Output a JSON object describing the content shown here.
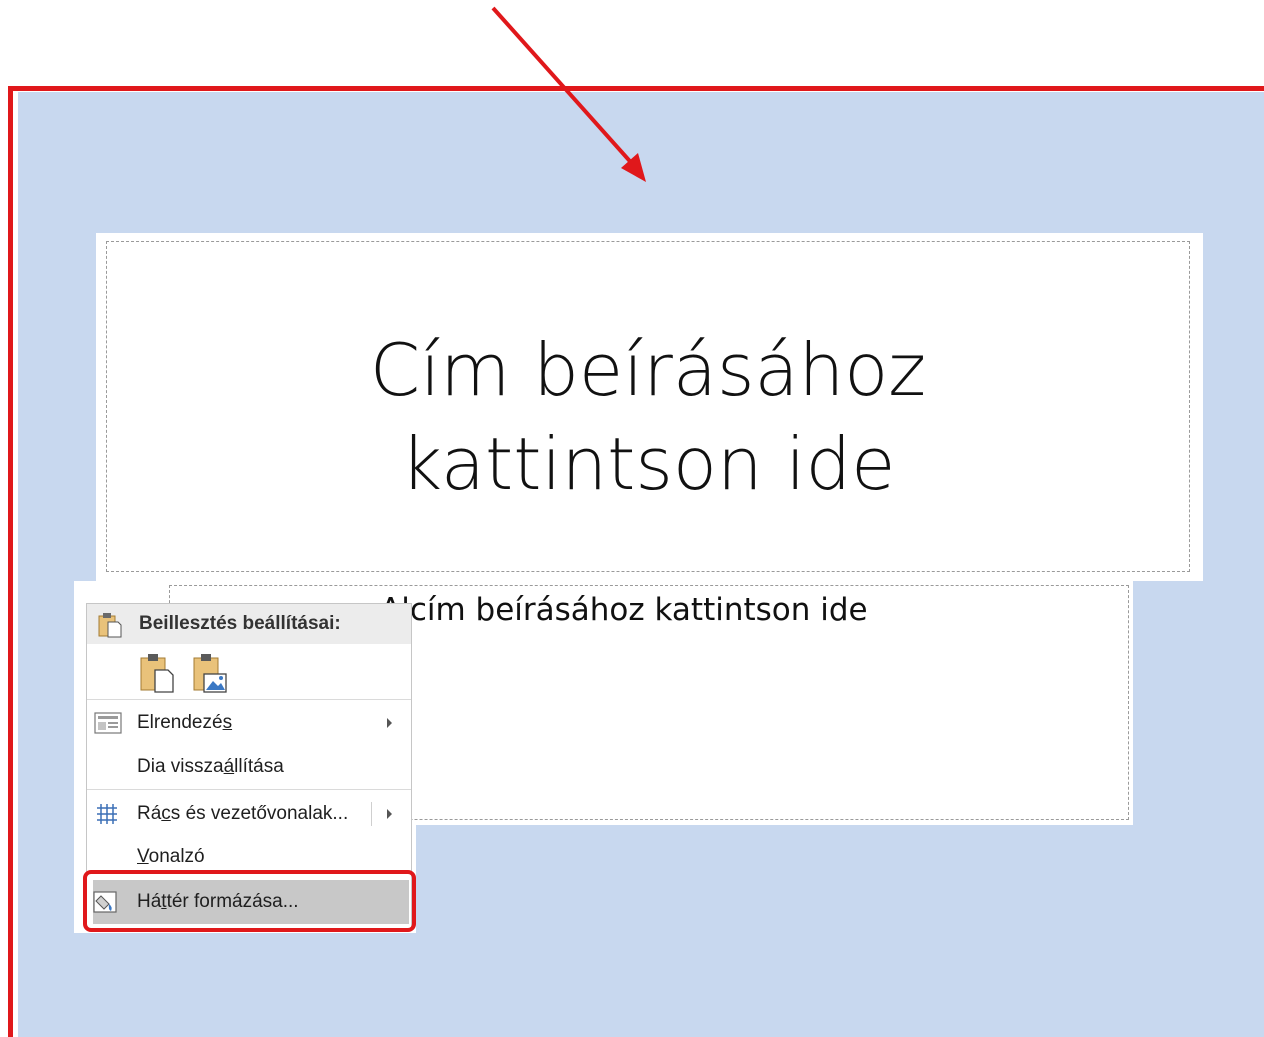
{
  "slide": {
    "title_placeholder": "Cím beírásához\nkattintson ide",
    "subtitle_placeholder": "Alcím beírásához kattintson ide"
  },
  "context_menu": {
    "paste_options_header": "Beillesztés beállításai:",
    "items": [
      {
        "label_pre": "Elrendezé",
        "label_ul": "s",
        "label_post": "",
        "has_submenu": true,
        "icon": "layout-icon"
      },
      {
        "label_pre": "Dia vissza",
        "label_ul": "á",
        "label_post": "llítása",
        "has_submenu": false,
        "icon": ""
      },
      {
        "label_pre": "Rá",
        "label_ul": "c",
        "label_post": "s és vezetővonalak...",
        "has_submenu": true,
        "icon": "grid-icon"
      },
      {
        "label_pre": "",
        "label_ul": "V",
        "label_post": "onalzó",
        "has_submenu": false,
        "icon": ""
      },
      {
        "label_pre": "Há",
        "label_ul": "t",
        "label_post": "tér formázása...",
        "has_submenu": false,
        "icon": "format-background-icon",
        "highlighted": true
      }
    ]
  },
  "colors": {
    "annotation_red": "#e0181b",
    "slide_background": "#c8d8ef",
    "menu_highlight": "#c8c8c8"
  }
}
